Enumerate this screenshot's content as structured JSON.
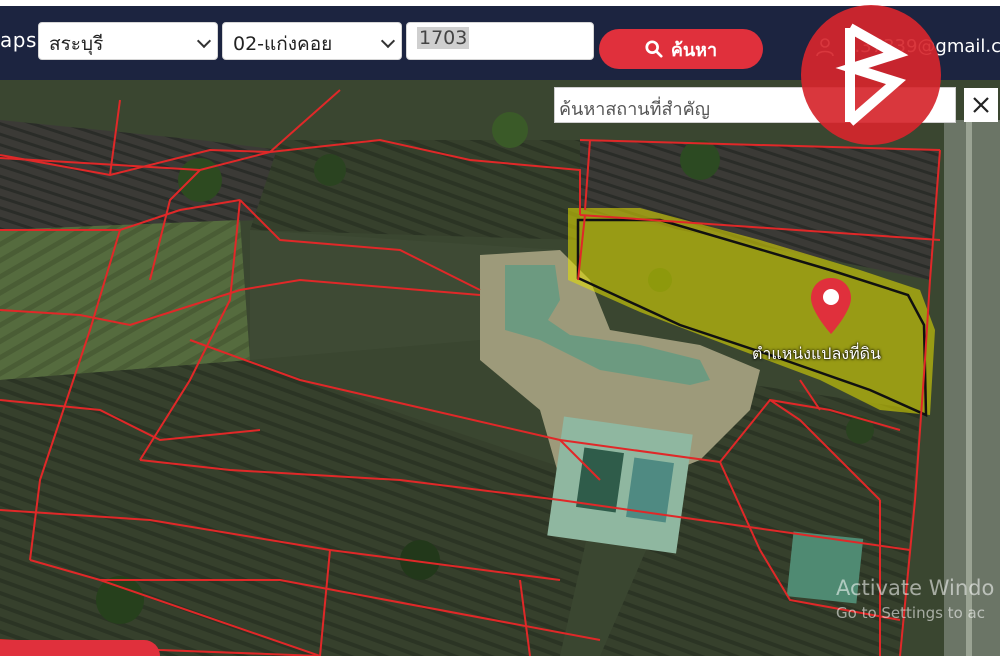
{
  "header": {
    "brand_text": "aps",
    "province_value": "สระบุรี",
    "district_value": "02-แก่งคอย",
    "parcel_value": "1703",
    "search_button_label": "ค้นหา",
    "user_email": "...37339@gmail.c"
  },
  "map": {
    "place_search_placeholder": "ค้นหาสถานที่สำคัญ",
    "marker_label": "ตำแหน่งแปลงที่ดิน",
    "parcel_boundary_color": "#e02828",
    "highlight_color": "#e6e100",
    "marker_color": "#e0303c",
    "watermark": {
      "line1": "Activate Windo",
      "line2": "Go to Settings to ac"
    }
  },
  "icons": {
    "search": "search-icon",
    "user": "user-icon",
    "close": "close-icon",
    "marker": "map-pin-icon",
    "logo": "brand-logo-icon"
  }
}
